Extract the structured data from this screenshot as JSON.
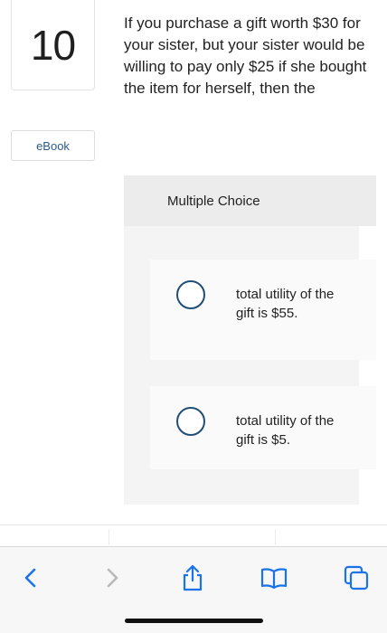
{
  "question": {
    "number": "10",
    "text": "If you purchase a gift worth $30 for your sister, but your sister would be willing to pay only $25 if she bought the item for herself, then the"
  },
  "ebook_label": "eBook",
  "multiple_choice": {
    "header": "Multiple Choice",
    "options": [
      {
        "text": "total utility of the gift is $55."
      },
      {
        "text": "total utility of the gift is $5."
      }
    ]
  },
  "toolbar": {
    "icons": [
      "back-chevron-icon",
      "forward-chevron-icon",
      "share-icon",
      "bookmarks-icon",
      "tabs-icon"
    ],
    "accent_color": "#1a73e8",
    "disabled_color": "#b9b9b9"
  }
}
